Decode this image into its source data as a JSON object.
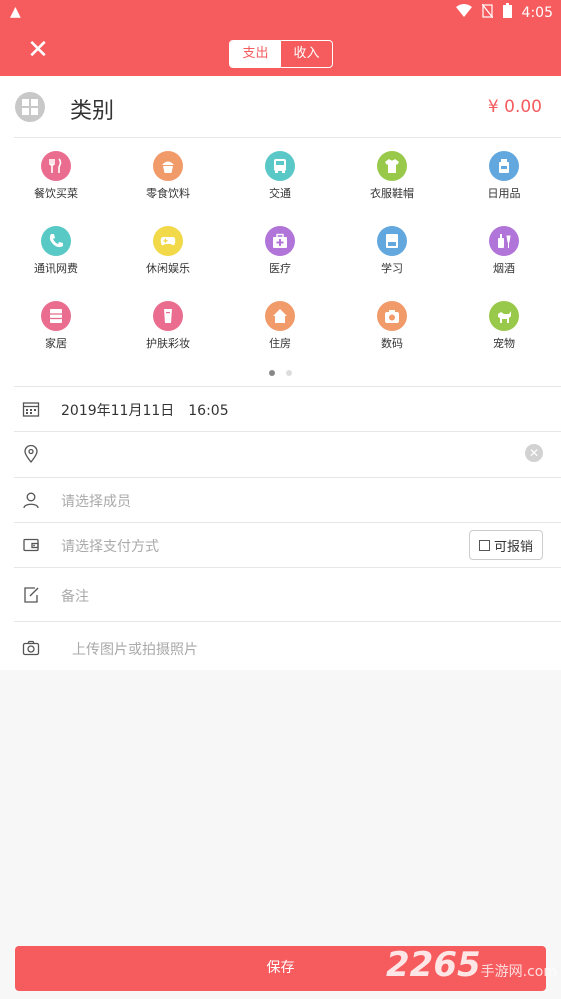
{
  "status_bar": {
    "time": "4:05"
  },
  "header": {
    "tabs": [
      {
        "label": "支出",
        "active": true
      },
      {
        "label": "收入",
        "active": false
      }
    ]
  },
  "category": {
    "title": "类别",
    "amount": "¥ 0.00"
  },
  "categories": [
    {
      "label": "餐饮买菜",
      "icon": "utensils-icon",
      "color": "#ea6d8f"
    },
    {
      "label": "零食饮料",
      "icon": "cupcake-icon",
      "color": "#f19a6a"
    },
    {
      "label": "交通",
      "icon": "bus-icon",
      "color": "#59c8c6"
    },
    {
      "label": "衣服鞋帽",
      "icon": "shirt-icon",
      "color": "#99c94b"
    },
    {
      "label": "日用品",
      "icon": "bottle-icon",
      "color": "#63a7df"
    },
    {
      "label": "通讯网费",
      "icon": "phone-icon",
      "color": "#58c9c5"
    },
    {
      "label": "休闲娱乐",
      "icon": "gamepad-icon",
      "color": "#f1d94a"
    },
    {
      "label": "医疗",
      "icon": "medkit-icon",
      "color": "#b174d8"
    },
    {
      "label": "学习",
      "icon": "book-icon",
      "color": "#63a7df"
    },
    {
      "label": "烟酒",
      "icon": "wine-icon",
      "color": "#b174d8"
    },
    {
      "label": "家居",
      "icon": "cabinet-icon",
      "color": "#ea6d8f"
    },
    {
      "label": "护肤彩妆",
      "icon": "cosmetic-icon",
      "color": "#ea6d8f"
    },
    {
      "label": "住房",
      "icon": "house-icon",
      "color": "#f19a6a"
    },
    {
      "label": "数码",
      "icon": "camera-icon",
      "color": "#f19a6a"
    },
    {
      "label": "宠物",
      "icon": "dog-icon",
      "color": "#99c94b"
    }
  ],
  "form": {
    "datetime": "2019年11月11日　16:05",
    "member_placeholder": "请选择成员",
    "payment_placeholder": "请选择支付方式",
    "reimbursable_label": "可报销",
    "note_placeholder": "备注",
    "photo_placeholder": "上传图片或拍摄照片"
  },
  "save_label": "保存",
  "watermark": {
    "brand": "2265",
    "suffix": "手游网",
    "domain": ".com"
  },
  "colors": {
    "accent": "#f65b5e"
  }
}
